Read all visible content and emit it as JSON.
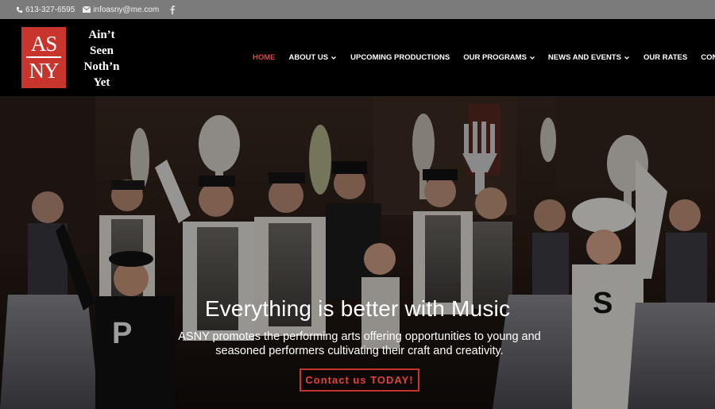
{
  "topbar": {
    "phone": "613-327-6595",
    "email": "infoasny@me.com"
  },
  "logo": {
    "line1": "AS",
    "line2": "NY"
  },
  "tagline": {
    "line1": "Ain’t",
    "line2": "Seen",
    "line3": "Noth’n",
    "line4": "Yet"
  },
  "nav": {
    "items": [
      {
        "label": "HOME"
      },
      {
        "label": "ABOUT US"
      },
      {
        "label": "UPCOMING PRODUCTIONS"
      },
      {
        "label": "OUR PROGRAMS"
      },
      {
        "label": "NEWS AND EVENTS"
      },
      {
        "label": "OUR RATES"
      },
      {
        "label": "CONTACT US"
      }
    ]
  },
  "hero": {
    "title": "Everything is better with Music",
    "text": "ASNY promotes the performing arts offering opportunities to young and seasoned performers cultivating their craft and creativity.",
    "cta_label": "Contact us TODAY!",
    "shirt_letter_left": "P",
    "shirt_letter_right": "S"
  },
  "colors": {
    "topbar_bg": "#7b7b7b",
    "header_bg": "#000000",
    "accent": "#c8352d",
    "nav_active": "#e0443a"
  }
}
